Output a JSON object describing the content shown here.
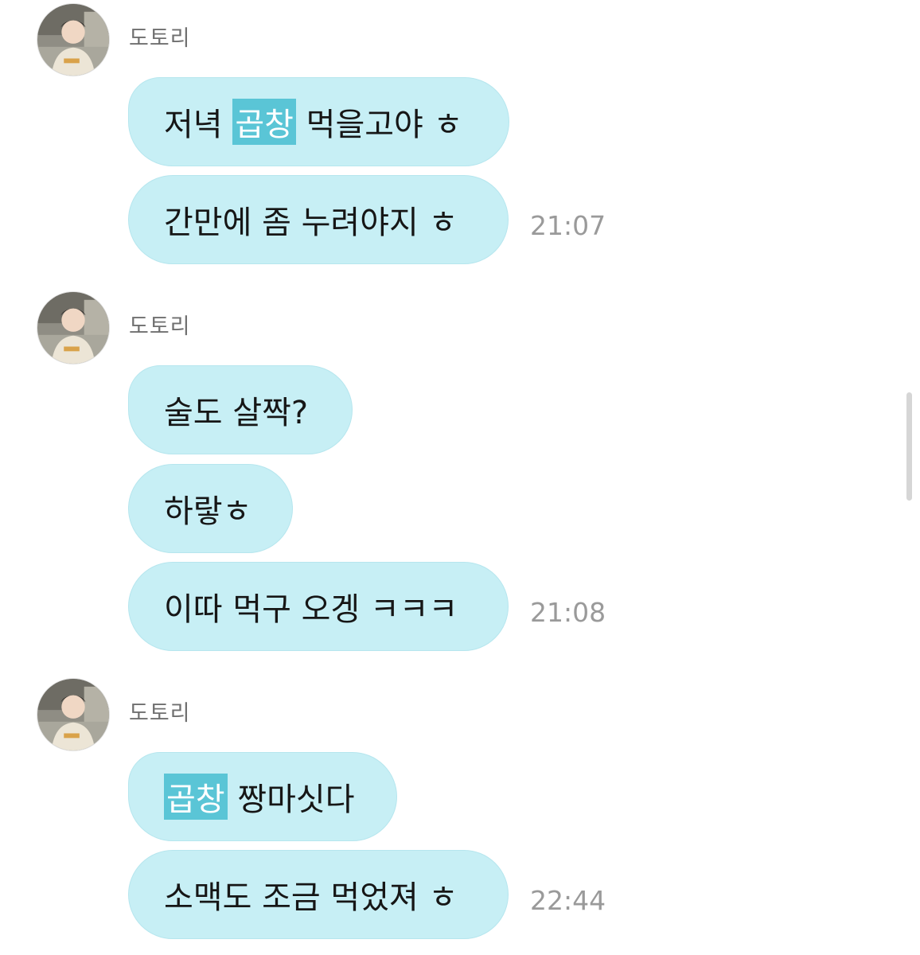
{
  "groups": [
    {
      "sender": "도토리",
      "messages": [
        {
          "pre": "저녁 ",
          "hl": "곱창",
          "post": " 먹을고야 ㅎ"
        },
        {
          "text": "간만에 좀 누려야지 ㅎ"
        }
      ],
      "time": "21:07"
    },
    {
      "sender": "도토리",
      "messages": [
        {
          "text": "술도 살짝?"
        },
        {
          "text": "하랗ㅎ"
        },
        {
          "text": "이따 먹구 오겡 ㅋㅋㅋ"
        }
      ],
      "time": "21:08"
    },
    {
      "sender": "도토리",
      "messages": [
        {
          "hl": "곱창",
          "post": " 짱마싯다"
        },
        {
          "text": "소맥도 조금 먹었져 ㅎ"
        }
      ],
      "time": "22:44"
    }
  ],
  "colors": {
    "bubble": "#c7eff5",
    "highlight": "#5ac5d6",
    "sender_text": "#6f6f6f",
    "time_text": "#9a9a9a"
  }
}
